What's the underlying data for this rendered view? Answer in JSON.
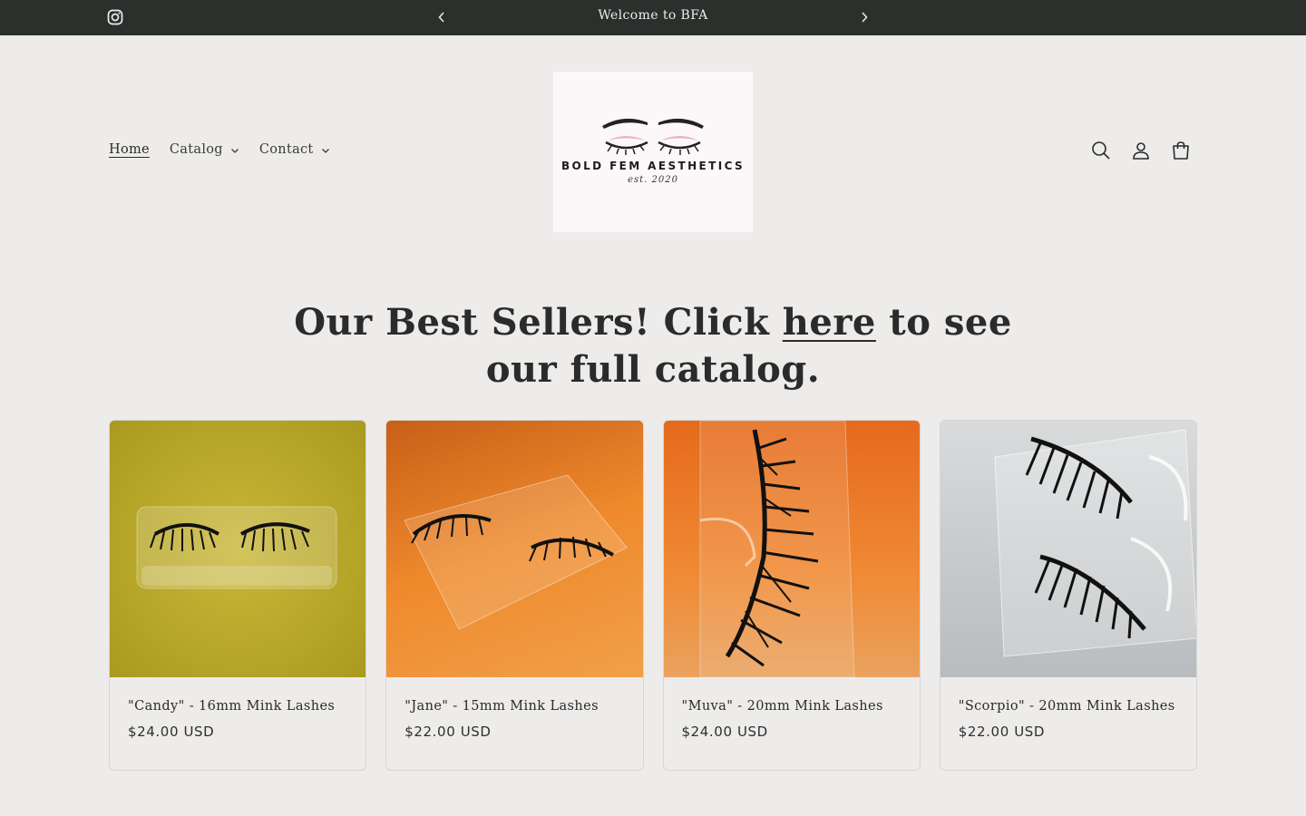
{
  "announcement": {
    "text": "Welcome to BFA"
  },
  "nav": {
    "items": [
      {
        "label": "Home",
        "active": true,
        "dropdown": false
      },
      {
        "label": "Catalog",
        "active": false,
        "dropdown": true
      },
      {
        "label": "Contact",
        "active": false,
        "dropdown": true
      }
    ]
  },
  "logo": {
    "brand": "BOLD FEM AESTHETICS",
    "est": "est. 2020"
  },
  "header_icons": [
    "search-icon",
    "account-icon",
    "cart-icon"
  ],
  "heading": {
    "before": "Our Best Sellers! Click ",
    "link": "here",
    "after": " to see our full catalog."
  },
  "products": [
    {
      "title": "\"Candy\" - 16mm Mink Lashes",
      "price": "$24.00 USD",
      "bg": "#bfae2a"
    },
    {
      "title": "\"Jane\" - 15mm Mink Lashes",
      "price": "$22.00 USD",
      "bg": "#e07a28"
    },
    {
      "title": "\"Muva\" - 20mm Mink Lashes",
      "price": "$24.00 USD",
      "bg": "#e5762a"
    },
    {
      "title": "\"Scorpio\" - 20mm Mink Lashes",
      "price": "$22.00 USD",
      "bg": "#c9cbcd"
    }
  ],
  "colors": {
    "announcement_bg": "#2b302d",
    "page_bg": "#edecea",
    "logo_bg": "#fcf8f9"
  }
}
